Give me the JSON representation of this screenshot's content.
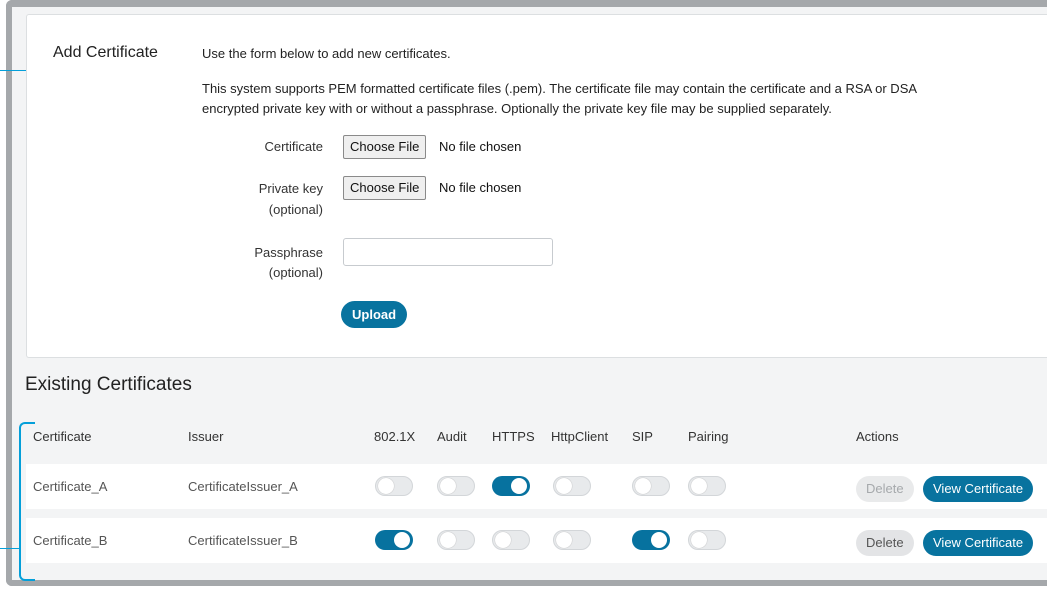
{
  "add_certificate": {
    "title": "Add Certificate",
    "intro": "Use the form below to add new certificates.",
    "desc_line1": "This system supports PEM formatted certificate files (.pem). The certificate file may contain the certificate and a RSA or DSA",
    "desc_line2": "encrypted private key with or without a passphrase. Optionally the private key file may be supplied separately.",
    "certificate_label": "Certificate",
    "private_key_label": "Private key",
    "private_key_optional": "(optional)",
    "passphrase_label": "Passphrase",
    "passphrase_optional": "(optional)",
    "choose_file_label": "Choose File",
    "no_file_label": "No file chosen",
    "passphrase_value": "",
    "upload_label": "Upload"
  },
  "existing": {
    "title": "Existing Certificates",
    "columns": [
      "Certificate",
      "Issuer",
      "802.1X",
      "Audit",
      "HTTPS",
      "HttpClient",
      "SIP",
      "Pairing",
      "Actions"
    ],
    "rows": [
      {
        "certificate": "Certificate_A",
        "issuer": "CertificateIssuer_A",
        "toggles": {
          "dot1x": false,
          "audit": false,
          "https": true,
          "httpclient": false,
          "sip": false,
          "pairing": false
        },
        "delete_label": "Delete",
        "delete_enabled": false,
        "view_label": "View Certificate"
      },
      {
        "certificate": "Certificate_B",
        "issuer": "CertificateIssuer_B",
        "toggles": {
          "dot1x": true,
          "audit": false,
          "https": false,
          "httpclient": false,
          "sip": true,
          "pairing": false
        },
        "delete_label": "Delete",
        "delete_enabled": true,
        "view_label": "View Certificate"
      }
    ]
  },
  "colors": {
    "accent": "#08739f",
    "callout": "#049fd9",
    "frame": "#a5a8ab"
  }
}
